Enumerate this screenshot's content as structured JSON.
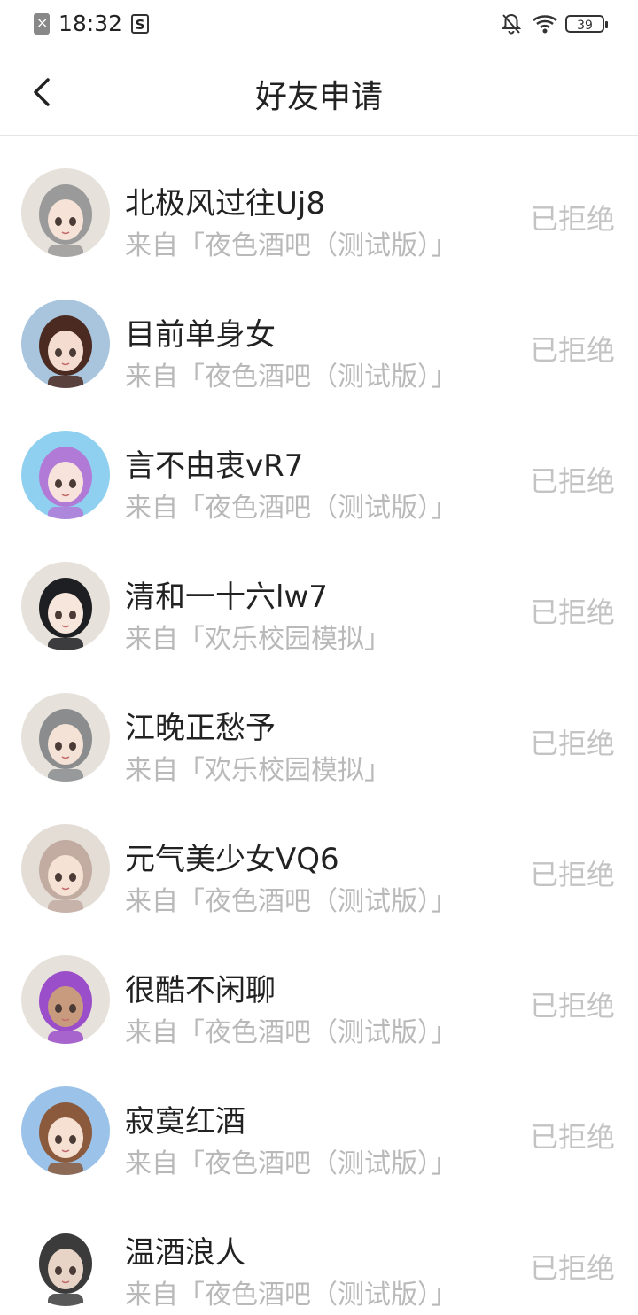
{
  "status_bar": {
    "time": "18:32",
    "battery": "39"
  },
  "header": {
    "title": "好友申请"
  },
  "requests": [
    {
      "name": "北极风过往Uj8",
      "source": "来自「夜色酒吧（测试版）」",
      "status": "已拒绝",
      "avatar_color": "#e6e1da",
      "hair": "#9a9a9a",
      "skin": "#f6e2d6"
    },
    {
      "name": "目前单身女",
      "source": "来自「夜色酒吧（测试版）」",
      "status": "已拒绝",
      "avatar_color": "#a8c5dd",
      "hair": "#4b2a22",
      "skin": "#f4ddd0"
    },
    {
      "name": "言不由衷vR7",
      "source": "来自「夜色酒吧（测试版）」",
      "status": "已拒绝",
      "avatar_color": "#8fd0f0",
      "hair": "#b27ad7",
      "skin": "#f7e3dc"
    },
    {
      "name": "清和一十六lw7",
      "source": "来自「欢乐校园模拟」",
      "status": "已拒绝",
      "avatar_color": "#e6e1da",
      "hair": "#1d1f22",
      "skin": "#f7e6db"
    },
    {
      "name": "江晚正愁予",
      "source": "来自「欢乐校园模拟」",
      "status": "已拒绝",
      "avatar_color": "#e6e1da",
      "hair": "#8a8c8e",
      "skin": "#f5e2d6"
    },
    {
      "name": "元气美少女VQ6",
      "source": "来自「夜色酒吧（测试版）」",
      "status": "已拒绝",
      "avatar_color": "#e3ddd6",
      "hair": "#c2aca2",
      "skin": "#f6e2d4"
    },
    {
      "name": "很酷不闲聊",
      "source": "来自「夜色酒吧（测试版）」",
      "status": "已拒绝",
      "avatar_color": "#e6e1da",
      "hair": "#9b4ec9",
      "skin": "#c89a7e"
    },
    {
      "name": "寂寞红酒",
      "source": "来自「夜色酒吧（测试版）」",
      "status": "已拒绝",
      "avatar_color": "#9bc2e9",
      "hair": "#8b5a3c",
      "skin": "#f6e0d2"
    },
    {
      "name": "温酒浪人",
      "source": "来自「夜色酒吧（测试版）」",
      "status": "已拒绝",
      "avatar_color": "#ffffff",
      "hair": "#3b3b3b",
      "skin": "#e7d4c6"
    }
  ]
}
